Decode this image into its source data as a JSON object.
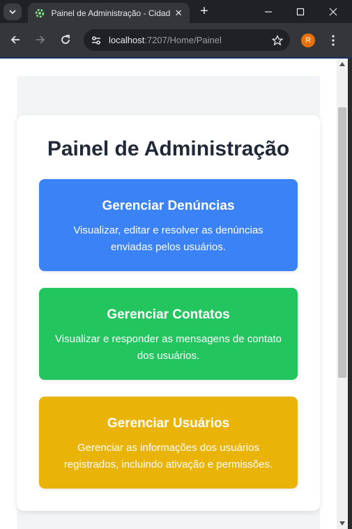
{
  "browser": {
    "tab_title": "Painel de Administração - Cidade",
    "new_tab_label": "+",
    "url_host": "localhost",
    "url_rest": ":7207/Home/Painel",
    "profile_initial": "R",
    "tab_close": "✕"
  },
  "page": {
    "title": "Painel de Administração",
    "cards": [
      {
        "title": "Gerenciar Denúncias",
        "description": "Visualizar, editar e resolver as denúncias enviadas pelos usuários.",
        "color": "#3b82f6"
      },
      {
        "title": "Gerenciar Contatos",
        "description": "Visualizar e responder as mensagens de contato dos usuários.",
        "color": "#22c55e"
      },
      {
        "title": "Gerenciar Usuários",
        "description": "Gerenciar as informações dos usuários registrados, incluindo ativação e permissões.",
        "color": "#eab308"
      }
    ]
  }
}
